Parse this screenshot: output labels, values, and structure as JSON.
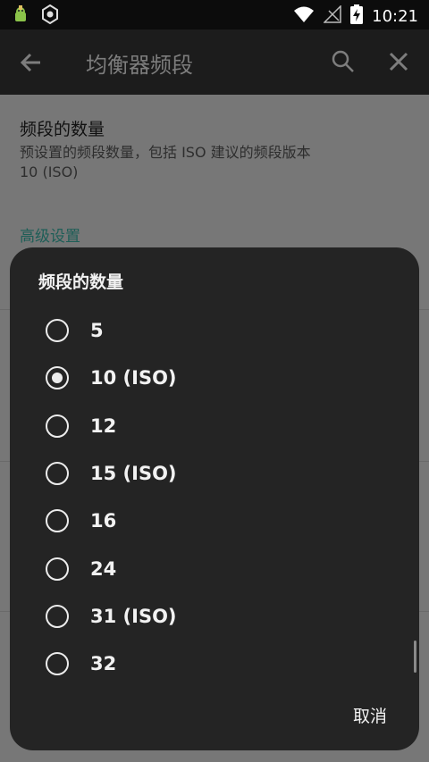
{
  "status_bar": {
    "time": "10:21"
  },
  "toolbar": {
    "title": "均衡器频段"
  },
  "preference": {
    "title": "频段的数量",
    "summary": "预设置的频段数量，包括 ISO 建议的频段版本",
    "value": "10 (ISO)",
    "category": "高级设置"
  },
  "dialog": {
    "title": "频段的数量",
    "options": [
      {
        "label": "5",
        "checked": false
      },
      {
        "label": "10 (ISO)",
        "checked": true
      },
      {
        "label": "12",
        "checked": false
      },
      {
        "label": "15 (ISO)",
        "checked": false
      },
      {
        "label": "16",
        "checked": false
      },
      {
        "label": "24",
        "checked": false
      },
      {
        "label": "31 (ISO)",
        "checked": false
      },
      {
        "label": "32",
        "checked": false
      }
    ],
    "cancel_label": "取消"
  },
  "colors": {
    "accent": "#1d5e57",
    "dialog_bg": "#242424",
    "toolbar_bg": "#1c1c1c"
  }
}
